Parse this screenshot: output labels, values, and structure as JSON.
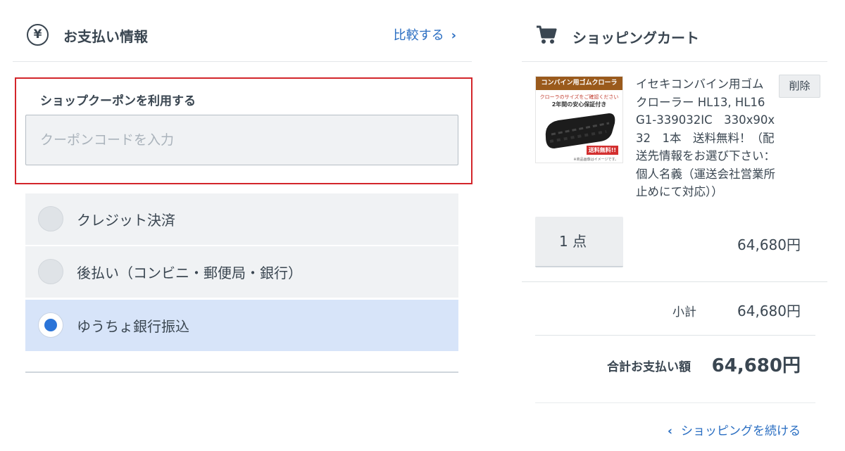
{
  "payment": {
    "title": "お支払い情報",
    "compare_link": "比較する",
    "coupon": {
      "label": "ショップクーポンを利用する",
      "placeholder": "クーポンコードを入力"
    },
    "methods": [
      {
        "label": "クレジット決済",
        "selected": false
      },
      {
        "label": "後払い（コンビニ・郵便局・銀行）",
        "selected": false
      },
      {
        "label": "ゆうちょ銀行振込",
        "selected": true
      }
    ],
    "selected_color": "#2b74d8",
    "icons": {
      "header": "yen-icon",
      "compare": "chevron-right-icon"
    }
  },
  "cart": {
    "title": "ショッピングカート",
    "item": {
      "name": "イセキコンバイン用ゴム クローラー HL13, HL16 G1-339032IC　330x90x32　1本　送料無料！（配送先情報をお選び下さい：個人名義（運送会社営業所止めにて対応））",
      "thumb_banner": "コンバイン用ゴムクローラ",
      "thumb_line1": "クローラのサイズをご確認ください",
      "thumb_line2": "2年間の安心保証付き",
      "thumb_badge": "送料無料!!",
      "thumb_note": "※商品画像はイメージです。",
      "delete_label": "削除",
      "quantity": "1 点",
      "price": "64,680円"
    },
    "subtotal_label": "小計",
    "subtotal_value": "64,680円",
    "total_label": "合計お支払い額",
    "total_value": "64,680円",
    "continue_link": "ショッピングを続ける",
    "icons": {
      "header": "cart-icon",
      "continue": "chevron-left-icon"
    }
  },
  "colors": {
    "link": "#2a6ec2",
    "highlight_border": "#d3252b",
    "selected_bg": "#d7e4f9"
  }
}
